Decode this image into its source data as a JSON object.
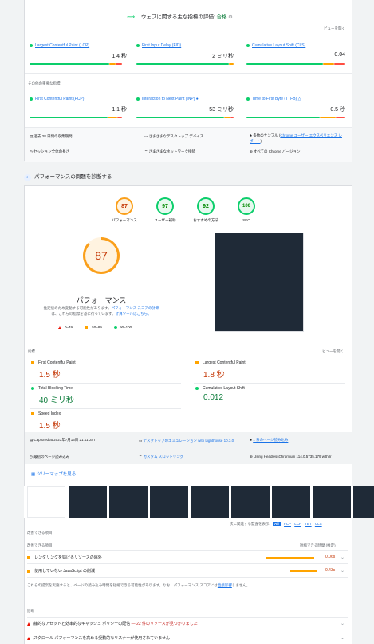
{
  "field": {
    "title": "ウェブに関する主な指標の評価:",
    "status": "合格",
    "expand": "ビューを開く",
    "metrics": [
      {
        "name": "Largest Contentful Paint (LCP)",
        "value": "1.4 秒"
      },
      {
        "name": "First Input Delay (FID)",
        "value": "2 ミリ秒"
      },
      {
        "name": "Cumulative Layout Shift (CLS)",
        "value": "0.04"
      }
    ],
    "other_label": "その他の重要な指標",
    "other_metrics": [
      {
        "name": "First Contentful Paint (FCP)",
        "value": "1.1 秒"
      },
      {
        "name": "Interaction to Next Paint (INP)",
        "value": "53 ミリ秒"
      },
      {
        "name": "Time to First Byte (TTFB)",
        "value": "0.5 秒"
      }
    ],
    "info": {
      "period": "過去 28 日間の収集期間",
      "devices": "さまざまなデスクトップ デバイス",
      "samples_prefix": "多数のサンプル (",
      "samples_link": "Chrome ユーザー エクスペリエンス レポート",
      "samples_suffix": ")",
      "session": "セッション全体の長さ",
      "network": "さまざまなネットワーク接続",
      "chrome": "すべての Chrome バージョン"
    }
  },
  "diagnose": {
    "title": "パフォーマンスの問題を診断する"
  },
  "scores": [
    {
      "value": "87",
      "label": "パフォーマンス",
      "color": "#fa9f1a"
    },
    {
      "value": "97",
      "label": "ユーザー補助",
      "color": "#0cce6b"
    },
    {
      "value": "92",
      "label": "おすすめの方法",
      "color": "#0cce6b"
    },
    {
      "value": "100",
      "label": "SEO",
      "color": "#0cce6b"
    }
  ],
  "perf": {
    "score": "87",
    "title": "パフォーマンス",
    "desc1": "推定値のため変動する可能性があります。",
    "desc_link1": "パフォーマンス スコアの計算",
    "desc2": "は、これらの指標を基に行っています。",
    "desc_link2": "計算ツールはこちら。",
    "legend": [
      "0–49",
      "50–89",
      "90–100"
    ]
  },
  "lab": {
    "label": "指標",
    "expand": "ビューを開く",
    "metrics": [
      {
        "name": "First Contentful Paint",
        "value": "1.5 秒",
        "status": "average"
      },
      {
        "name": "Largest Contentful Paint",
        "value": "1.8 秒",
        "status": "average"
      },
      {
        "name": "Total Blocking Time",
        "value": "40 ミリ秒",
        "status": "good"
      },
      {
        "name": "Cumulative Layout Shift",
        "value": "0.012",
        "status": "good"
      },
      {
        "name": "Speed Index",
        "value": "1.5 秒",
        "status": "average"
      }
    ]
  },
  "run_info": {
    "captured": "Captured at 2023年7月13日 21:11 JST",
    "emulation": "デスクトップのエミュレーション with Lighthouse 10.3.0",
    "page_load": "1 系のページ読み込み",
    "initial": "最初のページ読み込み",
    "throttling": "カスタム スロットリング",
    "browser": "Using HeadlessChromium 114.0.5735.179 with lr"
  },
  "treemap": "ツリーマップを見る",
  "filter": {
    "prefix": "次に関連する監査を表示:",
    "options": [
      "All",
      "FCP",
      "LCP",
      "TBT",
      "CLS"
    ]
  },
  "opportunities": {
    "section": "改善できる項目",
    "col_left": "改善できる項目",
    "col_right": "短縮できる時間 (推定)",
    "items": [
      {
        "title": "レンダリングを妨げるリソースの除外",
        "savings": "0.06s"
      },
      {
        "title": "使用していない JavaScript の削減",
        "savings": "0.43s"
      }
    ],
    "note_prefix": "これらの提案を実施すると、ページの読み込み時間を短縮できる可能性があります。なお、パフォーマンス スコアには",
    "note_link": "直接影響",
    "note_suffix": "しません。"
  },
  "diagnostics": {
    "section": "診断",
    "items": [
      {
        "title": "静的なアセットと効率的なキャッシュ ポリシーの配信",
        "detail": " — 22 件のリソースが見つかりました"
      },
      {
        "title": "スクロール パフォーマンスを高める受動的なリスナーが使用されていません",
        "detail": ""
      }
    ]
  },
  "colors": {
    "good": "#0cce6b",
    "average": "#ffa400",
    "poor": "#ff4e42",
    "link": "#1a73e8"
  }
}
